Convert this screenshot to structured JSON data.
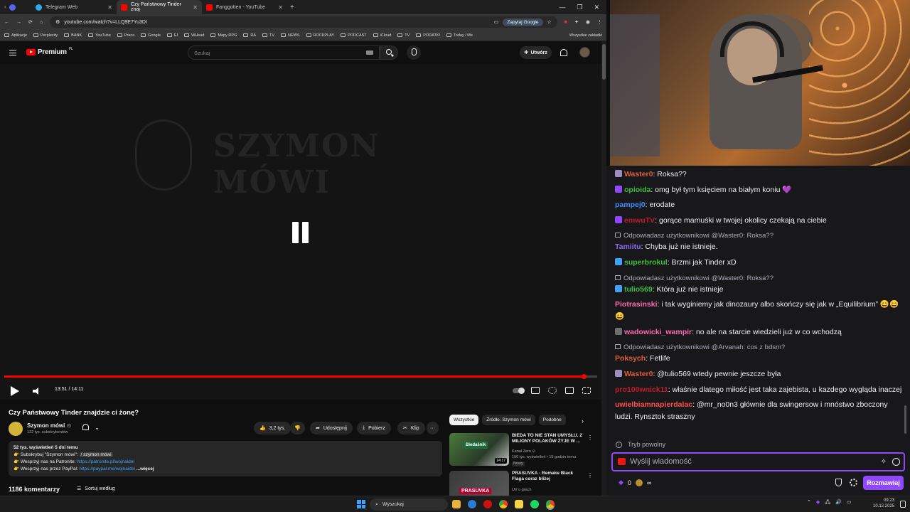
{
  "browser": {
    "tabs": [
      {
        "title": "Telegram Web",
        "color": "#2aabee",
        "active": false
      },
      {
        "title": "Czy Państwowy Tinder znaj",
        "color": "#ff0000",
        "active": true
      },
      {
        "title": "Fanggotten - YouTube",
        "color": "#ff0000",
        "active": false
      }
    ],
    "new_tab": "+",
    "window_controls": [
      "—",
      "❐",
      "✕"
    ],
    "url": "youtube.com/watch?v=LLQ9E7Yu3DI",
    "google_btn": "Zapytaj Google",
    "bookmarks": [
      "Aplikacje",
      "Perplexity",
      "BANK",
      "YouTube",
      "Praca",
      "Google",
      "EI",
      "WHead",
      "Mapy RPG",
      "RA",
      "TV",
      "NEWS",
      "ROCKPLAY",
      "PODCAST",
      "iCloud",
      "TV",
      "PODATKI",
      "Today / Me"
    ],
    "bookmarks_all": "Wszystkie zakładki"
  },
  "youtube": {
    "logo": "Premium",
    "country": "PL",
    "search_placeholder": "Szukaj",
    "create_label": "Utwórz",
    "player": {
      "art_text": "SZYMON MÓWI",
      "time": "13:51 / 14:11",
      "progress": 0.977
    },
    "video": {
      "title": "Czy Państwowy Tinder znajdzie ci żonę?",
      "channel": "Szymon mówi",
      "channel_verified": "⊙",
      "subscribers": "132 tys. subskrybentów",
      "likes": "3,2 tys.",
      "share": "Udostępnij",
      "download": "Pobierz",
      "clip": "Klip",
      "more": "···"
    },
    "description": {
      "stats": "52 tys. wyświetleń  5 dni temu",
      "line1_prefix": "👉 Subskrybuj \"Szymon mówi\": ",
      "line1_link": "/ szymon mówi",
      "line2_prefix": "👉 Wesprzyj nas na Patronite: ",
      "line2_link": "https://patronite.pl/wojnaidei",
      "line3_prefix": "👉 Wesprzyj nas przez PayPal: ",
      "line3_link": "https://paypal.me/wojnaidei",
      "more": " ...więcej"
    },
    "comments_count": "1186 komentarzy",
    "sort_label": "Sortuj według",
    "chips": [
      "Wszystkie",
      "Źródło: Szymon mówi",
      "Podobne"
    ],
    "chips_next": "›",
    "recommendations": [
      {
        "title": "BIEDA TO NIE STAN UMYSŁU. 2 MILIONY POLAKÓW ŻYJE W ...",
        "channel": "Kanał Zero ⊙",
        "meta": "150 tys. wyświetleń • 15 godzin temu",
        "badge": "Nowy",
        "duration": "24:17",
        "thumb_text": "Biedaśnik"
      },
      {
        "title": "PRASUVKA - Remake Black Flaga coraz bliżej",
        "channel": "UV o grach",
        "meta": "",
        "badge": "",
        "duration": "",
        "thumb_text": "PRASUVKA"
      }
    ]
  },
  "chat": {
    "messages": [
      {
        "reply": "",
        "user": "Waster0",
        "color": "#e05b3a",
        "badge": "#9b8dbd",
        "text": ": Roksa??"
      },
      {
        "reply": "",
        "user": "opioida",
        "color": "#3fbf3f",
        "badge": "#9147ff",
        "text": ": omg był tym księciem na białym koniu 💜"
      },
      {
        "reply": "",
        "user": "pampej0",
        "color": "#3f8cff",
        "badge": "",
        "text": ": erodate"
      },
      {
        "reply": "",
        "user": "emwuTV",
        "color": "#c51a2c",
        "badge": "#9147ff",
        "text": ": gorące mamuśki w twojej okolicy czekają na ciebie"
      },
      {
        "reply": "Odpowiadasz użytkownikowi @Waster0: Roksa??",
        "user": "Tamiitu",
        "color": "#8a6cf0",
        "badge": "",
        "text": ": Chyba już nie istnieje."
      },
      {
        "reply": "",
        "user": "superbrokul",
        "color": "#3fbf3f",
        "badge": "#3fa0f5",
        "text": ": Brzmi jak Tinder xD"
      },
      {
        "reply": "Odpowiadasz użytkownikowi @Waster0: Roksa??",
        "user": "tulio569",
        "color": "#3fbf3f",
        "badge": "#3fa0f5",
        "text": ": Która już nie istnieje"
      },
      {
        "reply": "",
        "user": "Piotrasinski",
        "color": "#ff69b4",
        "badge": "",
        "text": ": i tak wyginiemy jak dinozaury albo skończy się jak w „Equilibrium” 😄😄😄"
      },
      {
        "reply": "",
        "user": "wadowicki_wampir",
        "color": "#ff69b4",
        "badge": "#6e6e6e",
        "text": ": no ale na starcie wiedzieli już w co wchodzą"
      },
      {
        "reply": "Odpowiadasz użytkownikowi @Arvanah: cos z bdsm?",
        "user": "Poksych",
        "color": "#e05b3a",
        "badge": "",
        "text": ": Fetlife"
      },
      {
        "reply": "",
        "user": "Waster0",
        "color": "#e05b3a",
        "badge": "#9b8dbd",
        "text": ": @tulio569 wtedy pewnie jeszcze była"
      },
      {
        "reply": "",
        "user": "pro100wnick11",
        "color": "#c51a2c",
        "badge": "",
        "text": ": właśnie dlatego miłość jest taka zajebista, u kazdego wygląda inaczej"
      },
      {
        "reply": "",
        "user": "uwielbiamnapierdalac",
        "color": "#ff4d4d",
        "badge": "",
        "text": ": @mr_no0n3 głównie dla swingersow i mnóstwo zboczony ludzi. Rynsztok straszny"
      }
    ],
    "slow_mode": "Tryb powolny",
    "input_placeholder": "Wyślij wiadomość",
    "points": "0",
    "send_label": "Rozmawiaj"
  },
  "taskbar": {
    "search": "Wyszukaj",
    "time": "09:23",
    "date": "10.12.2025"
  }
}
